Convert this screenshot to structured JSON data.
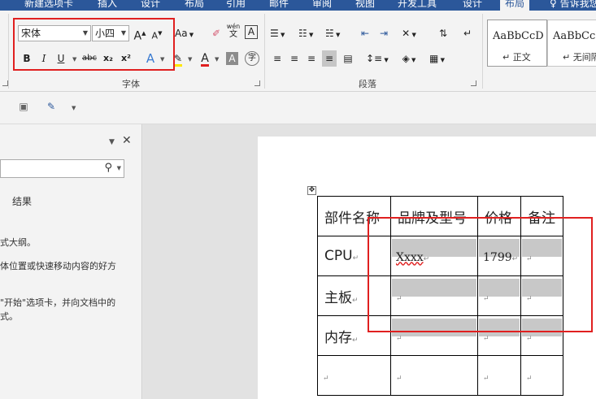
{
  "ribbon_tabs": [
    "新建选项卡",
    "插入",
    "设计",
    "布局",
    "引用",
    "邮件",
    "审阅",
    "视图",
    "开发工具",
    "设计",
    "布局",
    "告诉我您"
  ],
  "font_group": {
    "label": "字体",
    "font_name": "宋体",
    "font_size": "小四",
    "grow_font": "A",
    "shrink_font": "A",
    "change_case": "Aa",
    "phonetic_guide": "wén",
    "enclose_char": "A",
    "bold": "B",
    "italic": "I",
    "underline": "U",
    "strikethrough": "abc",
    "subscript": "x₂",
    "superscript": "x²",
    "text_effects": "A",
    "font_color": "A",
    "char_shading": "A",
    "enclose_circle": "字"
  },
  "paragraph_group": {
    "label": "段落"
  },
  "styles": [
    {
      "sample": "AaBbCcD",
      "name": "正文"
    },
    {
      "sample": "AaBbCcD",
      "name": "无间隔"
    }
  ],
  "nav_pane": {
    "results_tab": "结果",
    "line1": "式大纲。",
    "line2": "体位置或快速移动内容的好方",
    "line3": "\"开始\"选项卡，并向文档中的",
    "line4": "式。"
  },
  "table": {
    "headers": [
      "部件名称",
      "品牌及型号",
      "价格",
      "备注"
    ],
    "rows": [
      [
        "CPU",
        "Xxxx",
        "1799",
        ""
      ],
      [
        "主板",
        "",
        "",
        ""
      ],
      [
        "内存",
        "",
        "",
        ""
      ],
      [
        "",
        "",
        "",
        ""
      ]
    ]
  },
  "colors": {
    "tab_bg": "#2b579a",
    "highlight": "#e02020",
    "cell_shade": "#c8c8c8"
  }
}
